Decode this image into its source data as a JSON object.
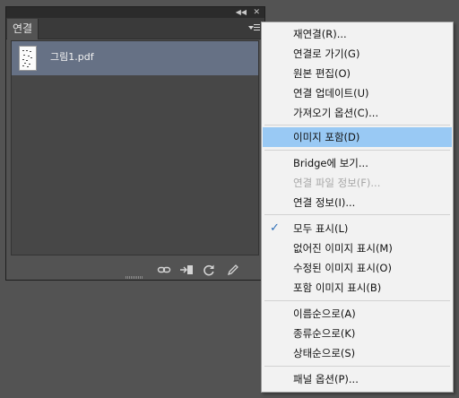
{
  "panel": {
    "tab_label": "연결",
    "links": [
      {
        "name": "그림1.pdf"
      }
    ],
    "icons": {
      "collapse": "double-arrow-icon",
      "close": "close-icon",
      "panel_menu": "panel-menu-icon",
      "relink": "chain-link-icon",
      "goto": "go-to-link-icon",
      "update": "refresh-icon",
      "edit": "pencil-icon"
    }
  },
  "menu": {
    "items": [
      {
        "label": "재연결(R)...",
        "disabled": false
      },
      {
        "label": "연결로 가기(G)",
        "disabled": false
      },
      {
        "label": "원본 편집(O)",
        "disabled": false
      },
      {
        "label": "연결 업데이트(U)",
        "disabled": false
      },
      {
        "label": "가져오기 옵션(C)...",
        "disabled": false
      },
      {
        "label": "이미지 포함(D)",
        "disabled": false,
        "highlighted": true
      },
      {
        "label": "Bridge에 보기...",
        "disabled": false
      },
      {
        "label": "연결 파일 정보(F)...",
        "disabled": true
      },
      {
        "label": "연결 정보(I)...",
        "disabled": false
      },
      {
        "label": "모두 표시(L)",
        "disabled": false,
        "checked": true
      },
      {
        "label": "없어진 이미지 표시(M)",
        "disabled": false
      },
      {
        "label": "수정된 이미지 표시(O)",
        "disabled": false
      },
      {
        "label": "포함 이미지 표시(B)",
        "disabled": false
      },
      {
        "label": "이름순으로(A)",
        "disabled": false
      },
      {
        "label": "종류순으로(K)",
        "disabled": false
      },
      {
        "label": "상태순으로(S)",
        "disabled": false
      },
      {
        "label": "패널 옵션(P)...",
        "disabled": false
      }
    ],
    "checkmark": "✓",
    "highlight_color": "#99c9f4"
  }
}
